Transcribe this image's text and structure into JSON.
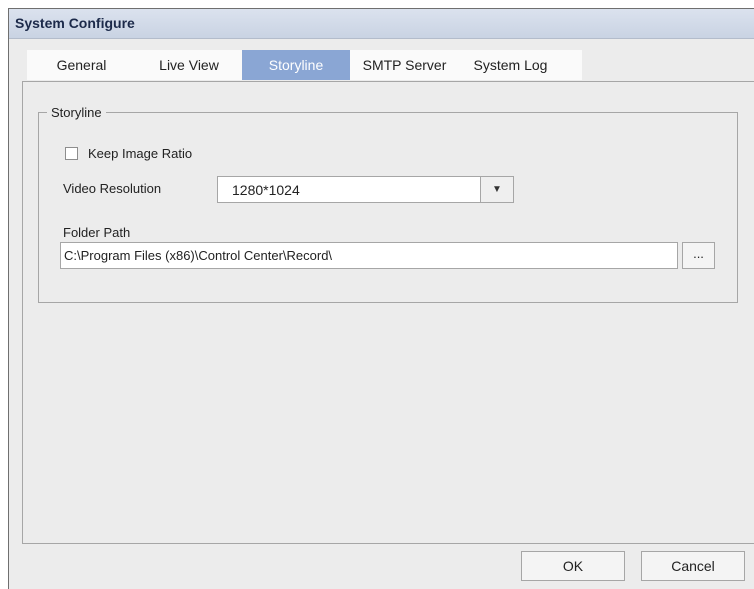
{
  "window": {
    "title": "System Configure"
  },
  "tabs": [
    {
      "label": "General"
    },
    {
      "label": "Live View"
    },
    {
      "label": "Storyline",
      "active": true
    },
    {
      "label": "SMTP Server"
    },
    {
      "label": "System Log"
    }
  ],
  "storyline": {
    "group_label": "Storyline",
    "keep_ratio_label": "Keep Image Ratio",
    "keep_ratio_checked": false,
    "video_resolution_label": "Video Resolution",
    "video_resolution_value": "1280*1024",
    "folder_path_label": "Folder Path",
    "folder_path_value": "C:\\Program Files (x86)\\Control Center\\Record\\",
    "browse_label": "..."
  },
  "footer": {
    "ok_label": "OK",
    "cancel_label": "Cancel"
  },
  "colors": {
    "title_bar": "#c9d3e3",
    "active_tab": "#8aa6d4",
    "panel": "#ececec"
  },
  "icons": {
    "dropdown": "caret-down-icon"
  }
}
